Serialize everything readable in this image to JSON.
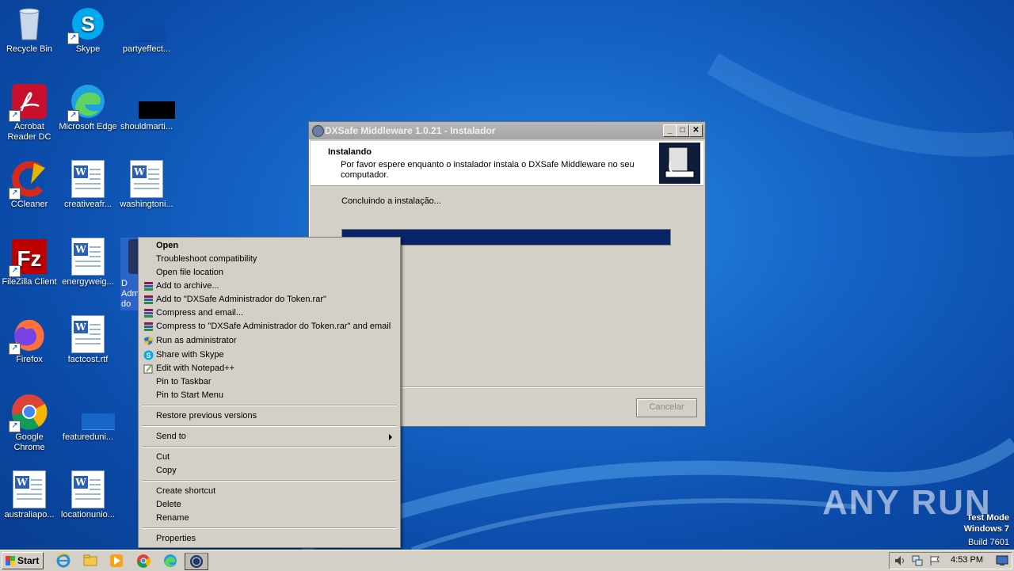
{
  "desktop": {
    "icons": [
      {
        "label": "Recycle Bin"
      },
      {
        "label": "Skype"
      },
      {
        "label": "partyeffect..."
      },
      {
        "label": "Acrobat Reader DC"
      },
      {
        "label": "Microsoft Edge"
      },
      {
        "label": "shouldmarti..."
      },
      {
        "label": "CCleaner"
      },
      {
        "label": "creativeafr..."
      },
      {
        "label": "washingtoni..."
      },
      {
        "label": "FileZilla Client"
      },
      {
        "label": "energyweig..."
      },
      {
        "label": "Firefox"
      },
      {
        "label": "factcost.rtf"
      },
      {
        "label": "Google Chrome"
      },
      {
        "label": "featureduni..."
      },
      {
        "label": "australiapo..."
      },
      {
        "label": "locationunio..."
      }
    ],
    "selected_partial_label": "D Adm do"
  },
  "installer": {
    "title": "DXSafe Middleware 1.0.21 - Instalador",
    "header_title": "Instalando",
    "header_subtitle": "Por favor espere enquanto o instalador instala o DXSafe Middleware no seu computador.",
    "status": "Concluindo a instalação...",
    "progress": 1.0,
    "cancel_label": "Cancelar",
    "min_label": "_",
    "max_label": "□",
    "close_label": "✕"
  },
  "context_menu": {
    "items": [
      {
        "label": "Open",
        "bold": true
      },
      {
        "label": "Troubleshoot compatibility"
      },
      {
        "label": "Open file location"
      },
      {
        "label": "Add to archive...",
        "icon": "winrar-icon"
      },
      {
        "label": "Add to \"DXSafe Administrador do Token.rar\"",
        "icon": "winrar-icon"
      },
      {
        "label": "Compress and email...",
        "icon": "winrar-icon"
      },
      {
        "label": "Compress to \"DXSafe Administrador do Token.rar\" and email",
        "icon": "winrar-icon"
      },
      {
        "label": "Run as administrator",
        "icon": "shield-icon"
      },
      {
        "label": "Share with Skype",
        "icon": "skype-icon"
      },
      {
        "label": "Edit with Notepad++",
        "icon": "notepad-icon"
      },
      {
        "label": "Pin to Taskbar"
      },
      {
        "label": "Pin to Start Menu"
      },
      {
        "label": "Restore previous versions"
      },
      {
        "label": "Send to"
      },
      {
        "label": "Cut"
      },
      {
        "label": "Copy"
      },
      {
        "label": "Create shortcut"
      },
      {
        "label": "Delete"
      },
      {
        "label": "Rename"
      },
      {
        "label": "Properties"
      }
    ]
  },
  "taskbar": {
    "start_label": "Start",
    "clock": "4:53 PM"
  },
  "watermark": {
    "text": "ANY RUN",
    "line1": "Test Mode",
    "line2": "Windows 7",
    "line3": "Build 7601"
  },
  "colors": {
    "progress_fill": "#0a246a",
    "desktop_bg": "#1566c8"
  }
}
